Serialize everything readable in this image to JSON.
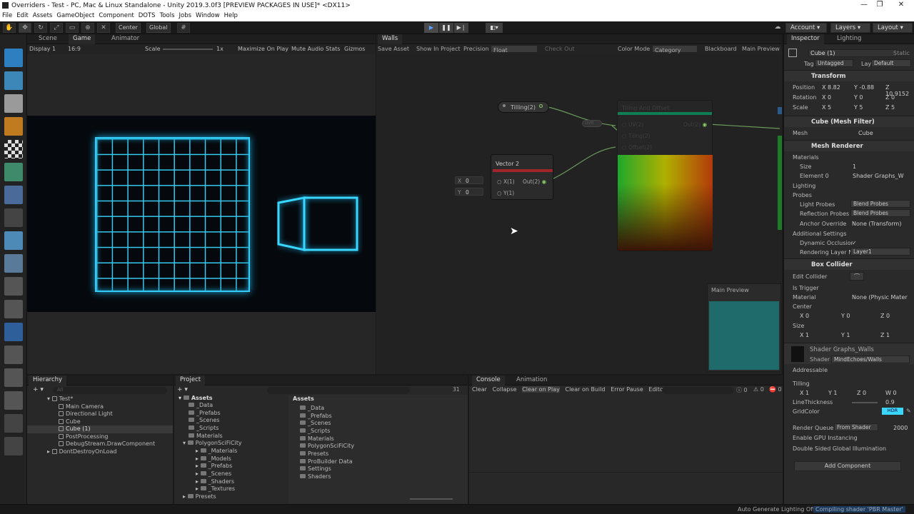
{
  "window": {
    "title": "Overriders - Test - PC, Mac & Linux Standalone - Unity 2019.3.0f3 [PREVIEW PACKAGES IN USE]* <DX11>",
    "minimize": "—",
    "maximize": "❐",
    "close": "✕"
  },
  "menu": [
    "File",
    "Edit",
    "Assets",
    "GameObject",
    "Component",
    "DOTS",
    "Tools",
    "Jobs",
    "Window",
    "Help"
  ],
  "toolbar": {
    "pivot": "Center",
    "space": "Global",
    "account": "Account",
    "layers": "Layers",
    "layout": "Layout"
  },
  "game": {
    "tabs": [
      "Scene",
      "Game",
      "Animator"
    ],
    "display": "Display 1",
    "aspect": "16:9",
    "scale_label": "Scale",
    "scale_value": "1x",
    "options": [
      "Maximize On Play",
      "Mute Audio",
      "Stats",
      "Gizmos"
    ]
  },
  "graph": {
    "tab": "Walls",
    "tools": [
      "Save Asset",
      "Show In Project",
      "Precision"
    ],
    "precision": "Float",
    "checkout": "Check Out",
    "colormode_label": "Color Mode",
    "colormode": "Category",
    "blackboard": "Blackboard",
    "mainpreview": "Main Preview",
    "tilling_node": "Tilling(2)",
    "vector_title": "Vector 2",
    "vector_x": "X(1)",
    "vector_y": "Y(1)",
    "vector_out": "Out(2)",
    "in_x_label": "X",
    "in_x_val": "0",
    "in_y_label": "Y",
    "in_y_val": "0",
    "offset_title": "Tiling And Offset",
    "offset_in": [
      "UV(2)",
      "Tiling(2)",
      "Offset(2)"
    ],
    "offset_out": "Out(2)",
    "uv_chip": "UV0",
    "preview_title": "Main Preview"
  },
  "inspector": {
    "tabs": [
      "Inspector",
      "Lighting"
    ],
    "object_name": "Cube (1)",
    "static": "Static",
    "tag_label": "Tag",
    "tag": "Untagged",
    "layer_label": "Layer",
    "layer": "Default",
    "transform": "Transform",
    "position_label": "Position",
    "pos": [
      "X  8.82",
      "Y  -0.88",
      "Z  10.9152"
    ],
    "rotation_label": "Rotation",
    "rot": [
      "X  0",
      "Y  0",
      "Z  0"
    ],
    "scale_label": "Scale",
    "scl": [
      "X  5",
      "Y  5",
      "Z  5"
    ],
    "meshfilter": "Cube (Mesh Filter)",
    "mesh_label": "Mesh",
    "mesh": "Cube",
    "meshrenderer": "Mesh Renderer",
    "materials": "Materials",
    "size_label": "Size",
    "size": "1",
    "element_label": "Element 0",
    "element": "Shader Graphs_W",
    "lighting": "Lighting",
    "probes": "Probes",
    "lightprobes_label": "Light Probes",
    "lightprobes": "Blend Probes",
    "reflprobes_label": "Reflection Probes",
    "reflprobes": "Blend Probes",
    "anchor_label": "Anchor Override",
    "anchor": "None (Transform)",
    "additional": "Additional Settings",
    "dyn_label": "Dynamic Occlusior",
    "dyn": "✓",
    "rlayer_label": "Rendering Layer M",
    "rlayer": "Layer1",
    "boxcollider": "Box Collider",
    "editcollider": "Edit Collider",
    "istrigger": "Is Trigger",
    "material_label": "Material",
    "material": "None (Physic Mater",
    "center_label": "Center",
    "center": [
      "X  0",
      "Y  0",
      "Z  0"
    ],
    "bsize_label": "Size",
    "bsize": [
      "X  1",
      "Y  1",
      "Z  1"
    ],
    "shadermat": "Shader Graphs_Walls",
    "shader_label": "Shader",
    "shader": "MindEchoes/Walls",
    "addressable": "Addressable",
    "tilling_label": "Tilling",
    "tilling": [
      "X  1",
      "Y  1",
      "Z  0",
      "W  0"
    ],
    "linethick_label": "LineThickness",
    "linethick": "0.9",
    "gridcolor_label": "GridColor",
    "gridcolor": "HDR",
    "rqueue_label": "Render Queue",
    "rqueue": "From Shader",
    "rqueue_val": "2000",
    "gpu_label": "Enable GPU Instancing",
    "dsgi_label": "Double Sided Global Illumination",
    "addcomp": "Add Component"
  },
  "hierarchy": {
    "tab": "Hierarchy",
    "search": "All",
    "items": [
      "Test*",
      "Main Camera",
      "Directional Light",
      "Cube",
      "Cube (1)",
      "PostProcessing",
      "DebugStream.DrawComponent",
      "DontDestroyOnLoad"
    ]
  },
  "project": {
    "tab": "Project",
    "count": "31",
    "tree": [
      "Assets",
      "_Data",
      "_Prefabs",
      "_Scenes",
      "_Scripts",
      "Materials",
      "PolygonSciFiCity",
      "_Materials",
      "_Models",
      "_Prefabs",
      "_Scenes",
      "_Shaders",
      "_Textures",
      "Presets",
      "ProBuilder Data"
    ],
    "header": "Assets",
    "files": [
      "_Data",
      "_Prefabs",
      "_Scenes",
      "_Scripts",
      "Materials",
      "PolygonSciFiCity",
      "Presets",
      "ProBuilder Data",
      "Settings",
      "Shaders"
    ]
  },
  "console": {
    "tabs": [
      "Console",
      "Animation"
    ],
    "buttons": [
      "Clear",
      "Collapse",
      "Clear on Play",
      "Clear on Build",
      "Error Pause",
      "Editor"
    ],
    "counts": [
      "0",
      "0",
      "0"
    ]
  },
  "status": {
    "autolight": "Auto Generate Lighting Off",
    "compiling": "Compiling shader 'PBR Master'"
  },
  "colors": {
    "accent": "#3a79bb",
    "neon": "#39d6ff",
    "graph_bg": "#222222",
    "panel": "#282828"
  }
}
